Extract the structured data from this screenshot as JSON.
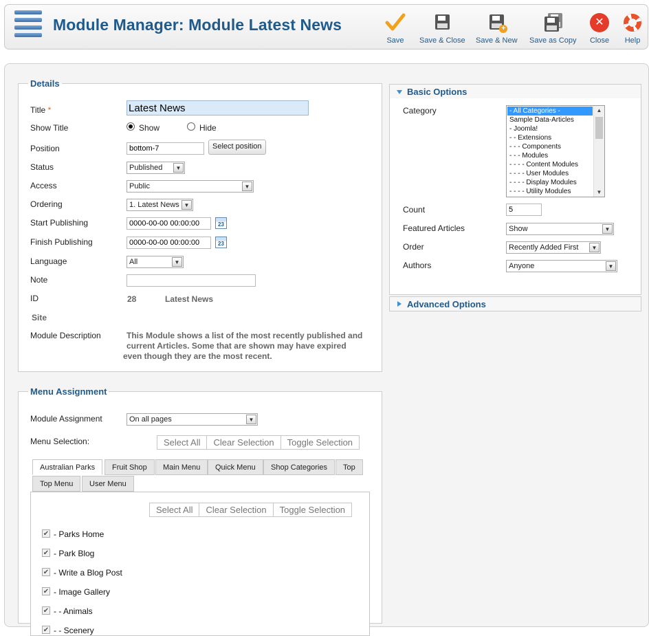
{
  "header": {
    "title": "Module Manager: Module Latest News",
    "buttons": [
      {
        "label": "Save"
      },
      {
        "label": "Save & Close"
      },
      {
        "label": "Save & New"
      },
      {
        "label": "Save as Copy"
      },
      {
        "label": "Close"
      },
      {
        "label": "Help"
      }
    ]
  },
  "details": {
    "legend": "Details",
    "title_label": "Title",
    "required_mark": "*",
    "title_value": "Latest News",
    "show_title_label": "Show Title",
    "show_option": "Show",
    "hide_option": "Hide",
    "show_title_selected": "Show",
    "position_label": "Position",
    "position_value": "bottom-7",
    "select_position_button": "Select position",
    "status_label": "Status",
    "status_value": "Published",
    "access_label": "Access",
    "access_value": "Public",
    "ordering_label": "Ordering",
    "ordering_value": "1. Latest News",
    "start_publishing_label": "Start Publishing",
    "start_publishing_value": "0000-00-00 00:00:00",
    "finish_publishing_label": "Finish Publishing",
    "finish_publishing_value": "0000-00-00 00:00:00",
    "calendar_icon_text": "23",
    "language_label": "Language",
    "language_value": "All",
    "note_label": "Note",
    "note_value": "",
    "id_label": "ID",
    "id_value": "28",
    "id_module_name": "Latest News",
    "site_label": "Site",
    "description_label": "Module Description",
    "description_lines": [
      "This Module shows a list of the most recently published and",
      "current Articles. Some that are shown may have expired",
      "even though they are the most recent."
    ]
  },
  "menu_assignment": {
    "legend": "Menu Assignment",
    "module_assignment_label": "Module Assignment",
    "module_assignment_value": "On all pages",
    "menu_selection_label": "Menu Selection:",
    "select_all": "Select All",
    "clear_selection": "Clear Selection",
    "toggle_selection": "Toggle Selection",
    "tabs": [
      {
        "label": "Australian Parks",
        "active": true
      },
      {
        "label": "Fruit Shop"
      },
      {
        "label": "Main Menu"
      },
      {
        "label": "Quick Menu"
      },
      {
        "label": "Shop Categories"
      },
      {
        "label": "Top"
      },
      {
        "label": "Top Menu"
      },
      {
        "label": "User Menu"
      }
    ],
    "items": [
      {
        "label": "- Parks Home",
        "checked": true
      },
      {
        "label": "- Park Blog",
        "checked": true
      },
      {
        "label": "- Write a Blog Post",
        "checked": true
      },
      {
        "label": "- Image Gallery",
        "checked": true
      },
      {
        "label": "- - Animals",
        "checked": true
      },
      {
        "label": "- - Scenery",
        "checked": true
      }
    ],
    "check_glyph": "✔"
  },
  "basic_options": {
    "title": "Basic Options",
    "category_label": "Category",
    "categories": [
      {
        "label": "- All Categories -",
        "selected": true
      },
      {
        "label": "Sample Data-Articles"
      },
      {
        "label": "- Joomla!"
      },
      {
        "label": "- - Extensions"
      },
      {
        "label": "- - - Components"
      },
      {
        "label": "- - - Modules"
      },
      {
        "label": "- - - - Content Modules"
      },
      {
        "label": "- - - - User Modules"
      },
      {
        "label": "- - - - Display Modules"
      },
      {
        "label": "- - - - Utility Modules"
      }
    ],
    "count_label": "Count",
    "count_value": "5",
    "featured_label": "Featured Articles",
    "featured_value": "Show",
    "order_label": "Order",
    "order_value": "Recently Added First",
    "authors_label": "Authors",
    "authors_value": "Anyone"
  },
  "advanced_options": {
    "title": "Advanced Options"
  },
  "colors": {
    "heading_blue": "#1f5a8c",
    "required_orange": "#e6641a",
    "selection_blue": "#3399ff"
  },
  "icons": {
    "header": "menu-manager-icon",
    "save": "checkmark-icon",
    "save_close": "floppy-disk-icon",
    "save_new": "floppy-disk-plus-icon",
    "save_copy": "floppy-disk-copy-icon",
    "close": "close-circle-icon",
    "help": "lifebuoy-icon",
    "calendar": "calendar-icon"
  }
}
